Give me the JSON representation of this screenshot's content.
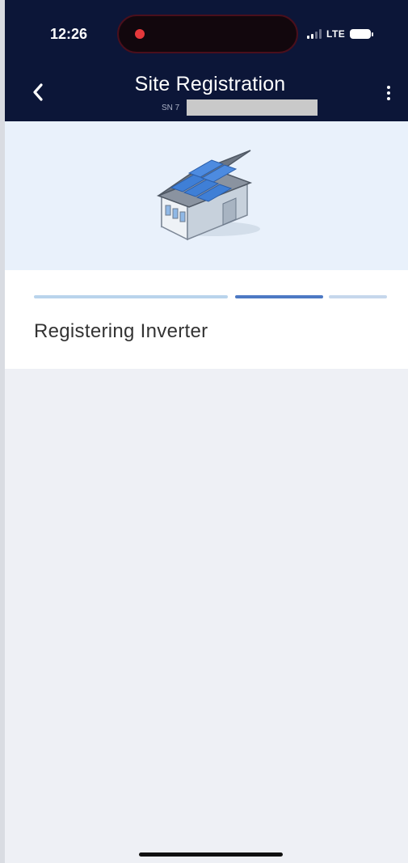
{
  "status_bar": {
    "time": "12:26",
    "network": "LTE",
    "signal_icon": "signal-bars-icon",
    "battery_icon": "battery-icon",
    "recording_indicator": "recording-dot-icon"
  },
  "header": {
    "title": "Site Registration",
    "serial_prefix": "SN 7",
    "back_icon": "chevron-left-icon",
    "menu_icon": "more-vertical-icon",
    "background_color": "#0c1638"
  },
  "hero": {
    "illustration_icon": "house-with-solar-panels-icon",
    "background_color": "#e9f1fb"
  },
  "progress": {
    "current_step_label": "Registering Inverter",
    "step_count": 3,
    "current_step": 2,
    "active_color": "#4d79c4"
  }
}
